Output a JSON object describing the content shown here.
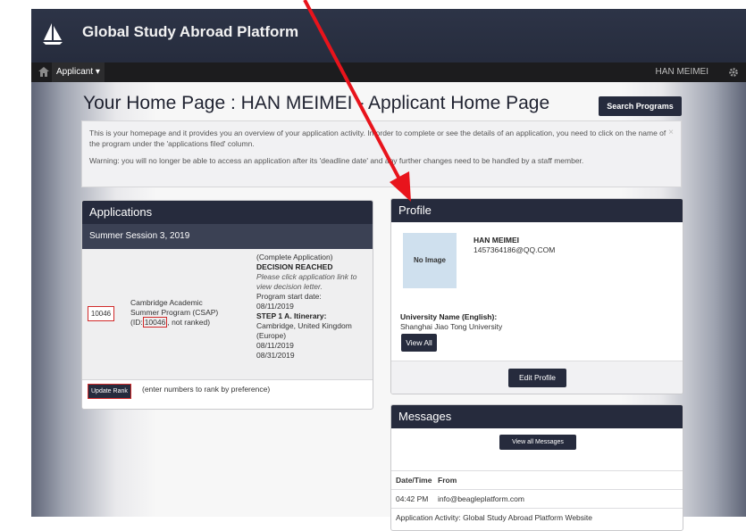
{
  "app": {
    "title": "Global Study Abroad Platform"
  },
  "nav": {
    "applicant_label": "Applicant ▾",
    "user_label": "HAN MEIMEI"
  },
  "page": {
    "title": "Your Home Page : HAN MEIMEI - Applicant Home Page",
    "search_button": "Search Programs",
    "info_paragraph_1": "This is your homepage and it provides you an overview of your application activity. In order to complete or see the details of an application, you need to click on the name of the program under the 'applications filed' column.",
    "info_paragraph_2": "Warning: you will no longer be able to access an application after its 'deadline date' and any further changes need to be handled by a staff member.",
    "info_close": "×"
  },
  "applications": {
    "heading": "Applications",
    "session": "Summer Session 3, 2019",
    "row": {
      "rank_value": "10046",
      "program_name": "Cambridge Academic Summer Program (CSAP)",
      "id_prefix": "(ID:",
      "id_value": "10046",
      "id_suffix": ", not ranked)",
      "status_line": "(Complete Application)",
      "decision": "DECISION REACHED",
      "decision_note": "Please click application link to view decision letter.",
      "start_label": "Program start date:",
      "start_date": "08/11/2019",
      "itinerary_label": "STEP 1 A. Itinerary:",
      "itinerary_place": "Cambridge, United Kingdom (Europe)",
      "itinerary_from": "08/11/2019",
      "itinerary_to": "08/31/2019"
    },
    "update_rank_button": "Update Rank",
    "rank_hint": "(enter numbers to rank by preference)"
  },
  "profile": {
    "heading": "Profile",
    "image_placeholder": "No Image",
    "name": "HAN MEIMEI",
    "email": "1457364186@QQ.COM",
    "university_label": "University Name (English):",
    "university_value": "Shanghai Jiao Tong University",
    "view_all_button": "View All",
    "edit_button": "Edit Profile"
  },
  "messages": {
    "heading": "Messages",
    "view_all_button": "View all Messages",
    "col_datetime": "Date/Time",
    "col_from": "From",
    "rows": [
      {
        "time": "04:42 PM",
        "from": "info@beagleplatform.com"
      }
    ],
    "activity": "Application Activity: Global Study Abroad Platform Website"
  },
  "colors": {
    "header_bg": "#2d3447",
    "panel_head": "#262b3d",
    "highlight_red": "#d12a2a",
    "annotation_arrow": "#e8141c"
  },
  "icons": {
    "home": "home-icon",
    "settings": "gear-icon",
    "logo": "sailboat-logo-icon"
  }
}
